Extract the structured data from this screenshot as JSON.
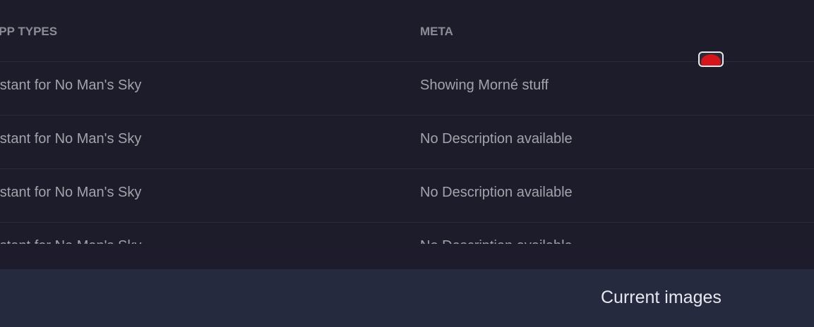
{
  "table": {
    "headers": {
      "types": "APP TYPES",
      "meta": "META"
    },
    "rows": [
      {
        "types": "Assistant for No Man's Sky",
        "meta": "Showing Morné stuff"
      },
      {
        "types": "Assistant for No Man's Sky",
        "meta": "No Description available"
      },
      {
        "types": "Assistant for No Man's Sky",
        "meta": "No Description available"
      },
      {
        "types": "Assistant for No Man's Sky",
        "meta": "No Description available"
      }
    ]
  },
  "panel": {
    "title": "Current images"
  },
  "icons": {
    "remove": "red-circle-icon"
  },
  "colors": {
    "background": "#1c1c2a",
    "panel": "#262a3f",
    "accent_red": "#d4161c"
  }
}
